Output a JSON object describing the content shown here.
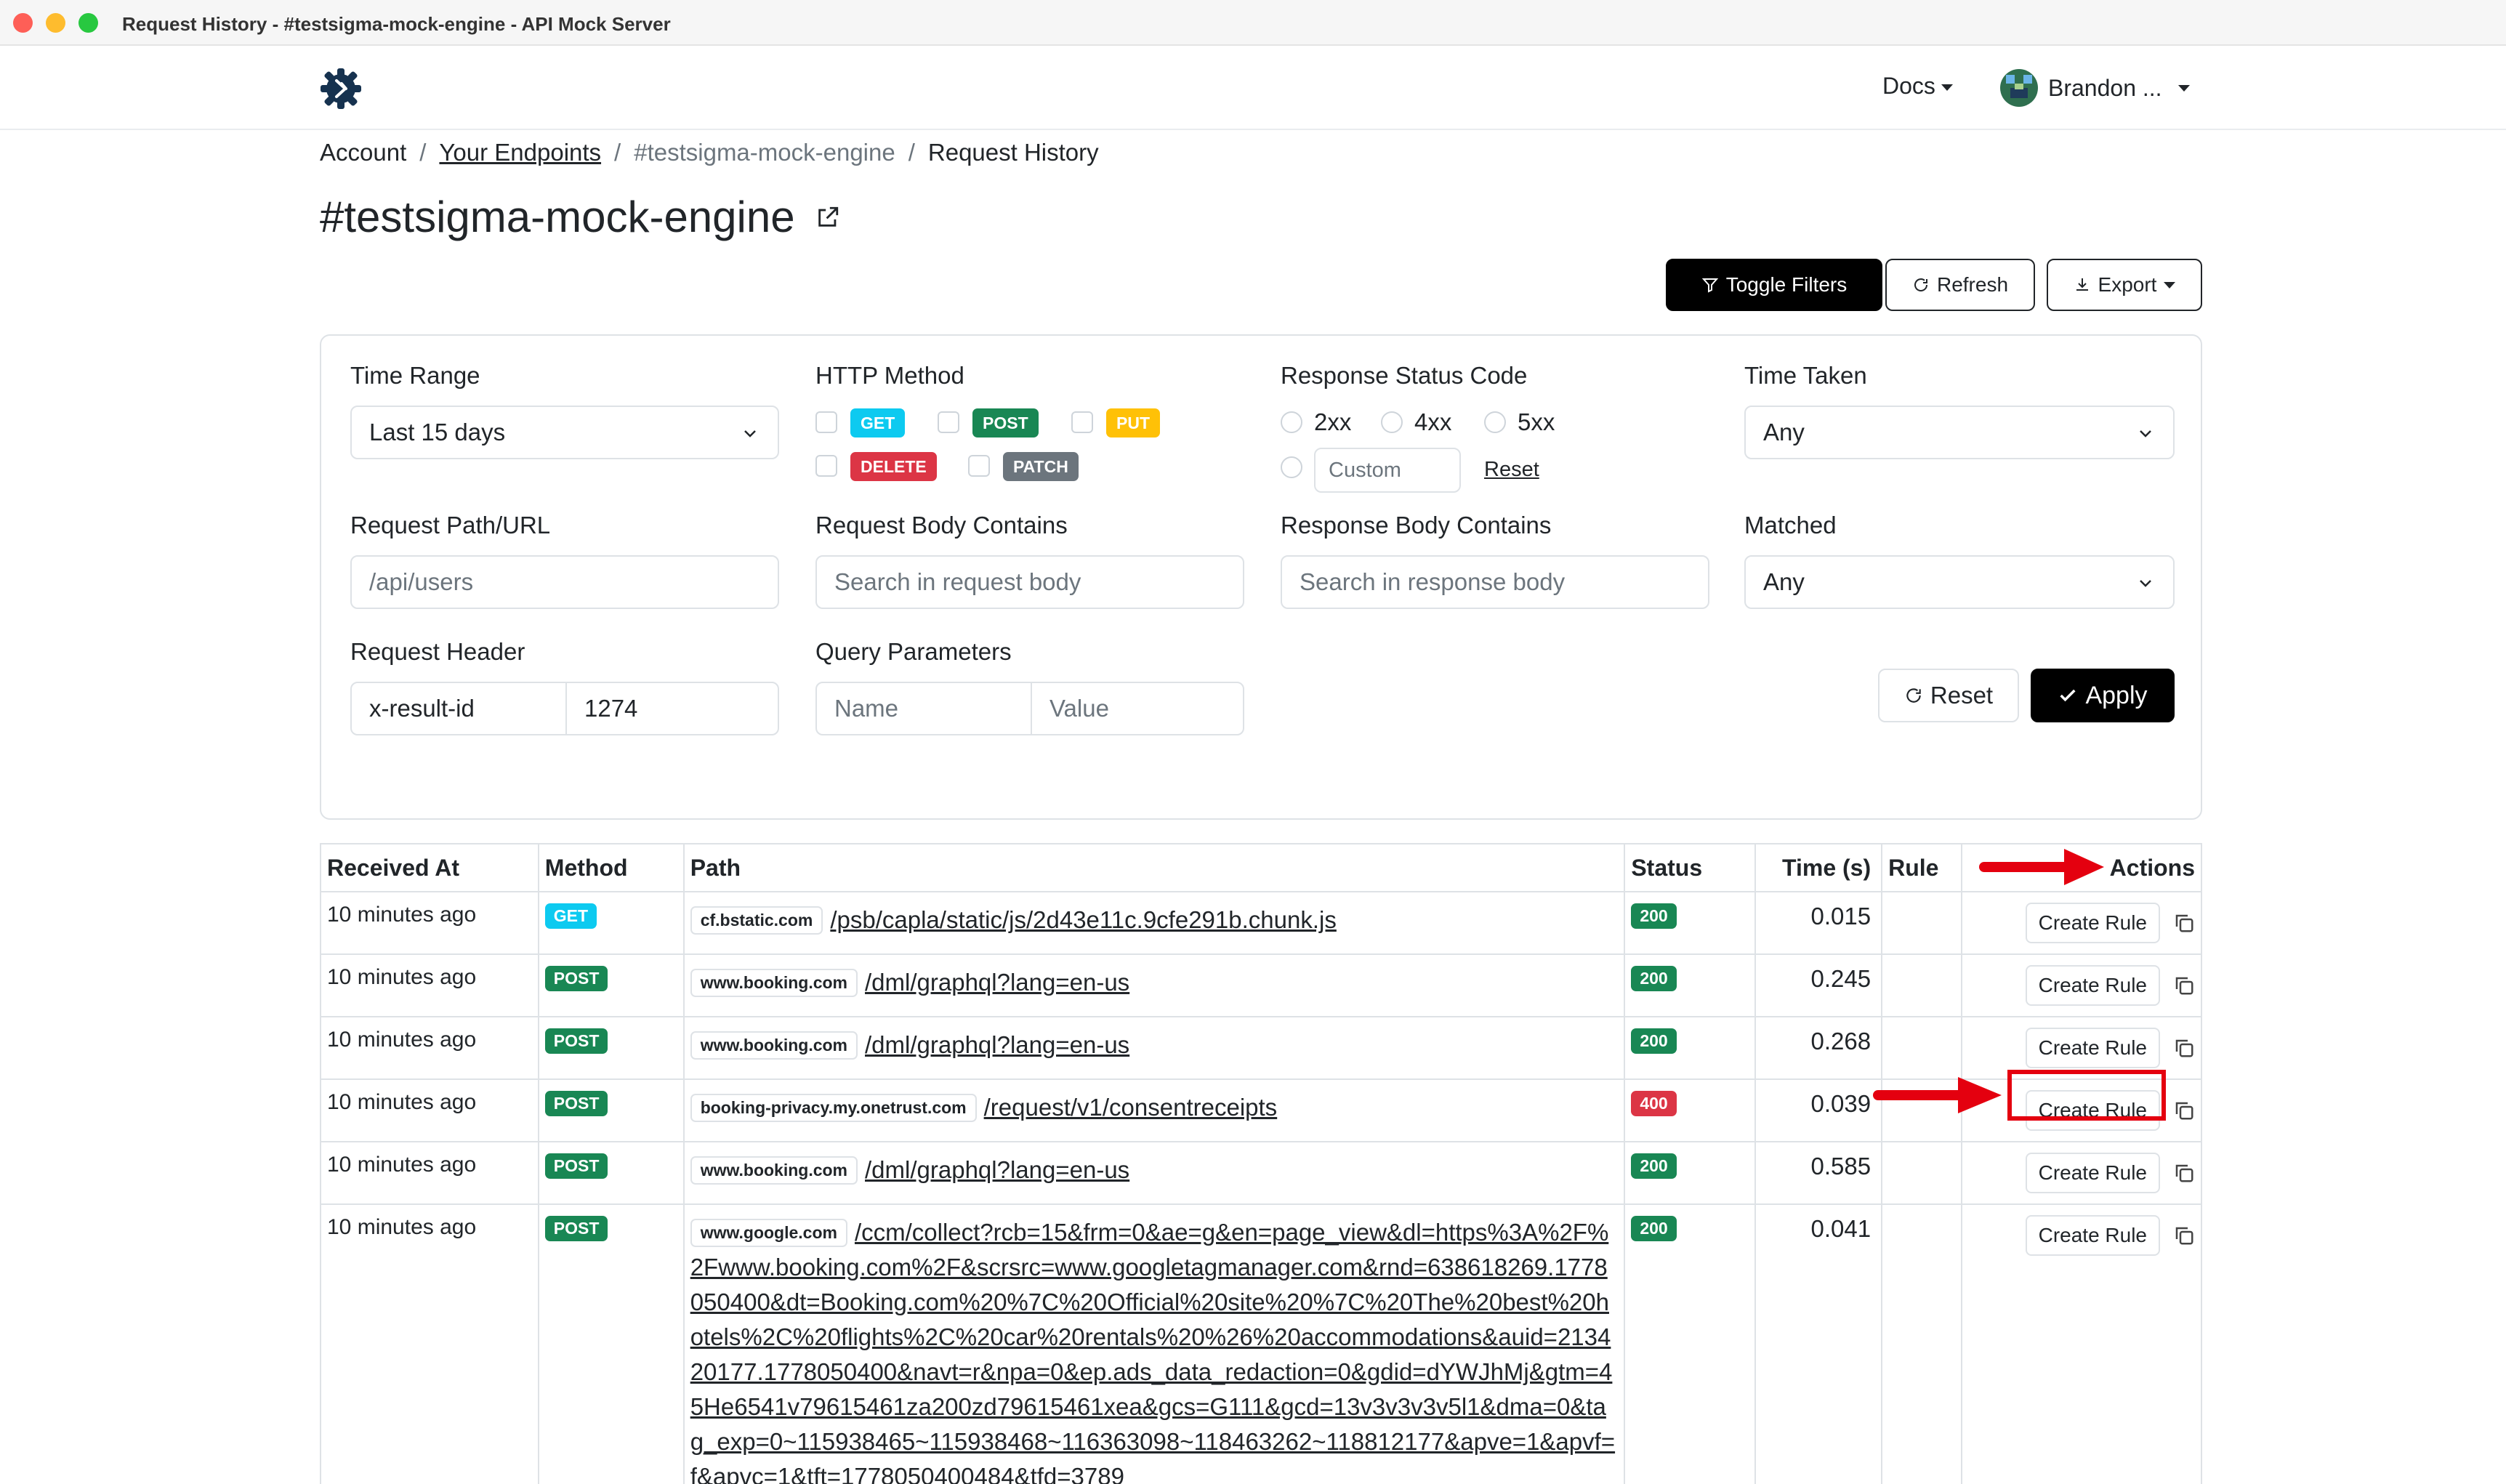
{
  "window": {
    "title": "Request History - #testsigma-mock-engine - API Mock Server"
  },
  "navbar": {
    "docs_label": "Docs",
    "user_name": "Brandon ..."
  },
  "breadcrumb": [
    "Account",
    "Your Endpoints",
    "#testsigma-mock-engine",
    "Request History"
  ],
  "page_title": "#testsigma-mock-engine",
  "toolbar": {
    "toggle_filters": "Toggle Filters",
    "refresh": "Refresh",
    "export": "Export"
  },
  "filters": {
    "time_range": {
      "label": "Time Range",
      "value": "Last 15 days"
    },
    "http_method": {
      "label": "HTTP Method",
      "methods": [
        "GET",
        "POST",
        "PUT",
        "DELETE",
        "PATCH"
      ]
    },
    "status_code": {
      "label": "Response Status Code",
      "options": [
        "2xx",
        "4xx",
        "5xx"
      ],
      "custom_placeholder": "Custom",
      "reset": "Reset"
    },
    "time_taken": {
      "label": "Time Taken",
      "value": "Any"
    },
    "path": {
      "label": "Request Path/URL",
      "placeholder": "/api/users"
    },
    "request_body": {
      "label": "Request Body Contains",
      "placeholder": "Search in request body"
    },
    "response_body": {
      "label": "Response Body Contains",
      "placeholder": "Search in response body"
    },
    "matched": {
      "label": "Matched",
      "value": "Any"
    },
    "request_header": {
      "label": "Request Header",
      "name": "x-result-id",
      "value": "1274"
    },
    "query_params": {
      "label": "Query Parameters",
      "name_placeholder": "Name",
      "value_placeholder": "Value"
    },
    "reset_label": "Reset",
    "apply_label": "Apply"
  },
  "table": {
    "headers": [
      "Received At",
      "Method",
      "Path",
      "Status",
      "Time (s)",
      "Rule",
      "Actions"
    ],
    "create_rule_label": "Create Rule",
    "rows": [
      {
        "received": "10 minutes ago",
        "method": "GET",
        "host": "cf.bstatic.com",
        "path": "/psb/capla/static/js/2d43e11c.9cfe291b.chunk.js",
        "status": "200",
        "time": "0.015"
      },
      {
        "received": "10 minutes ago",
        "method": "POST",
        "host": "www.booking.com",
        "path": "/dml/graphql?lang=en-us",
        "status": "200",
        "time": "0.245"
      },
      {
        "received": "10 minutes ago",
        "method": "POST",
        "host": "www.booking.com",
        "path": "/dml/graphql?lang=en-us",
        "status": "200",
        "time": "0.268"
      },
      {
        "received": "10 minutes ago",
        "method": "POST",
        "host": "booking-privacy.my.onetrust.com",
        "path": "/request/v1/consentreceipts",
        "status": "400",
        "time": "0.039"
      },
      {
        "received": "10 minutes ago",
        "method": "POST",
        "host": "www.booking.com",
        "path": "/dml/graphql?lang=en-us",
        "status": "200",
        "time": "0.585"
      },
      {
        "received": "10 minutes ago",
        "method": "POST",
        "host": "www.google.com",
        "path": "/ccm/collect?rcb=15&frm=0&ae=g&en=page_view&dl=https%3A%2F%2Fwww.booking.com%2F&scrsrc=www.googletagmanager.com&rnd=638618269.1778050400&dt=Booking.com%20%7C%20Official%20site%20%7C%20The%20best%20hotels%2C%20flights%2C%20car%20rentals%20%26%20accommodations&auid=213420177.1778050400&navt=r&npa=0&ep.ads_data_redaction=0&gdid=dYWJhMj&gtm=45He6541v79615461za200zd79615461xea&gcs=G111&gcd=13v3v3v3v5l1&dma=0&tag_exp=0~115938465~115938468~116363098~118463262~118812177&apve=1&apvf=f&apvc=1&tft=1778050400484&tfd=3789",
        "status": "200",
        "time": "0.041"
      }
    ]
  },
  "colors": {
    "get": "#0dcaf0",
    "post": "#198754",
    "put": "#ffc107",
    "delete": "#dc3545",
    "patch": "#6c757d",
    "status_ok": "#198754",
    "status_error": "#dc3545",
    "annotation": "#e4000f"
  }
}
